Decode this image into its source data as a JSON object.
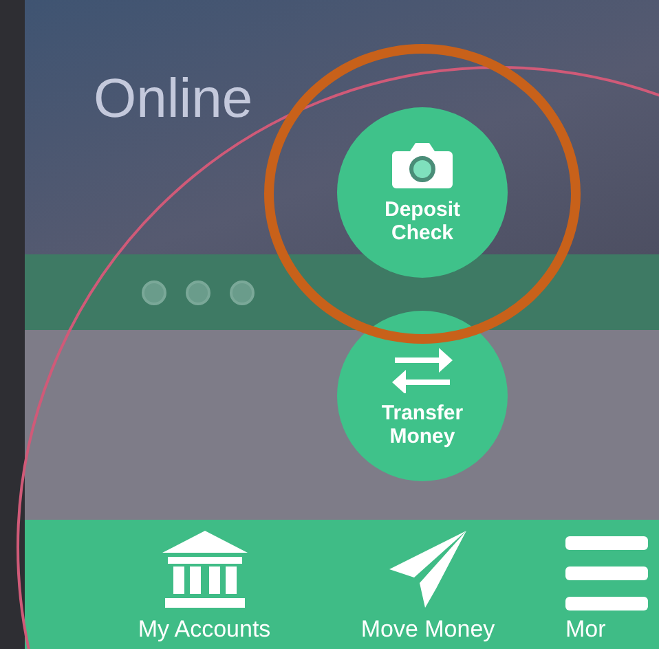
{
  "hero": {
    "title": "Online"
  },
  "actions": [
    {
      "label": "Deposit Check",
      "kind": "camera"
    },
    {
      "label": "Transfer Money",
      "kind": "transfer"
    }
  ],
  "nav": [
    {
      "label": "My Accounts",
      "kind": "bank"
    },
    {
      "label": "Move Money",
      "kind": "send"
    },
    {
      "label": "Mor",
      "kind": "menu"
    }
  ]
}
